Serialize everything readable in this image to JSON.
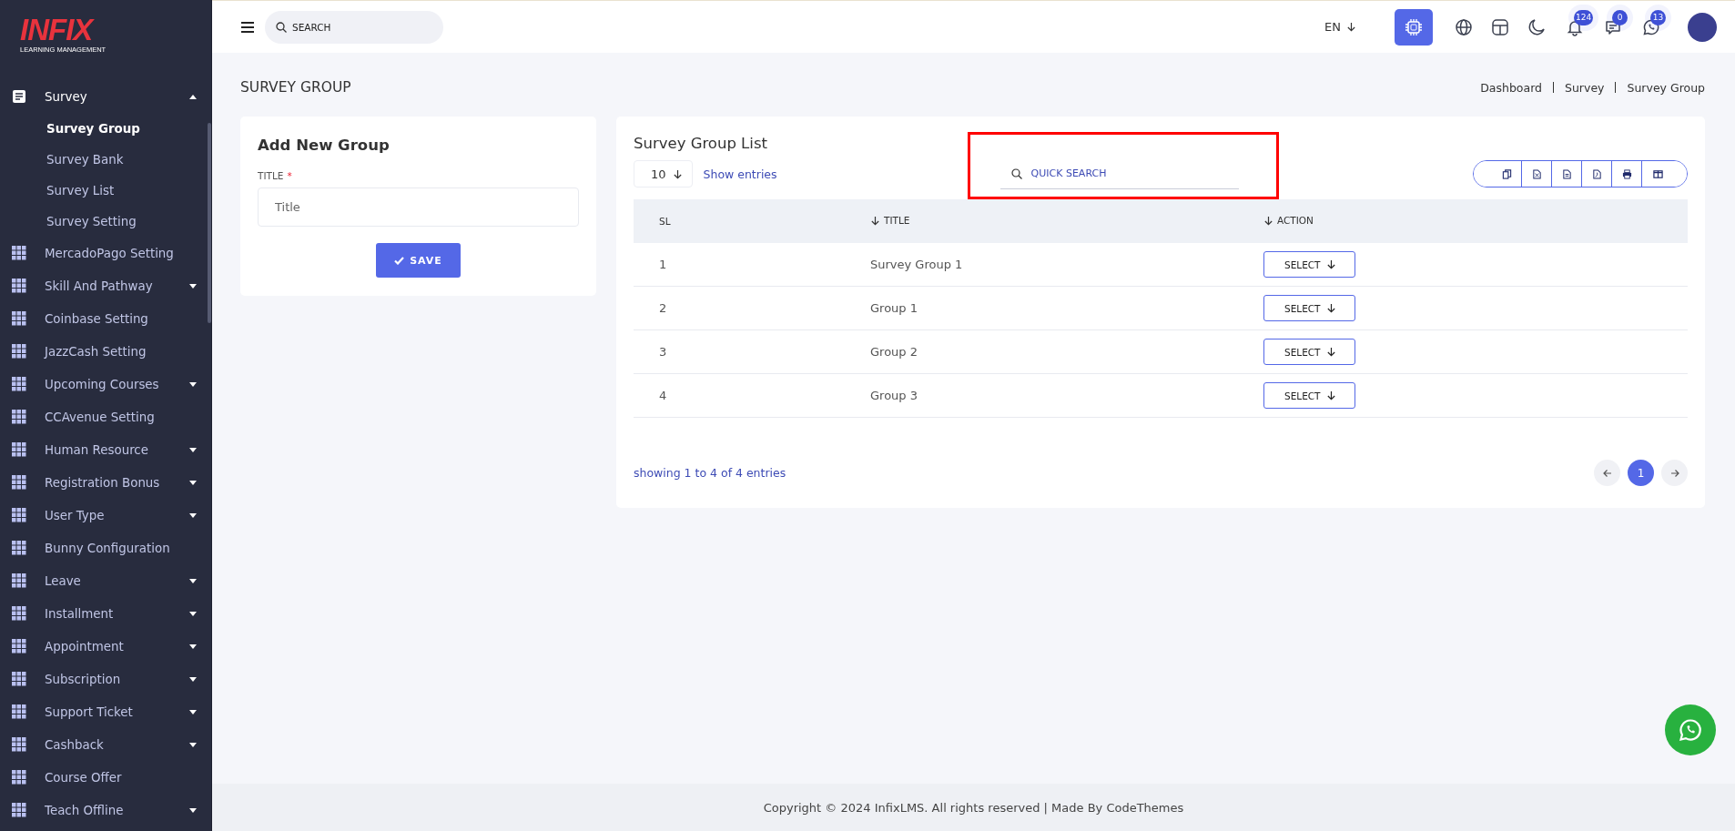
{
  "logo": {
    "wordmark": "INFIX",
    "tagline": "LEARNING MANAGEMENT"
  },
  "sidebar": {
    "items": [
      {
        "label": "Survey",
        "kind": "doc",
        "expandable": true,
        "expanded": true,
        "children": [
          {
            "label": "Survey Group",
            "selected": true
          },
          {
            "label": "Survey Bank",
            "selected": false
          },
          {
            "label": "Survey List",
            "selected": false
          },
          {
            "label": "Survey Setting",
            "selected": false
          }
        ]
      },
      {
        "label": "MercadoPago Setting",
        "kind": "grid",
        "expandable": false
      },
      {
        "label": "Skill And Pathway",
        "kind": "grid",
        "expandable": true,
        "expanded": false
      },
      {
        "label": "Coinbase Setting",
        "kind": "grid",
        "expandable": false
      },
      {
        "label": "JazzCash Setting",
        "kind": "grid",
        "expandable": false
      },
      {
        "label": "Upcoming Courses",
        "kind": "grid",
        "expandable": true,
        "expanded": false
      },
      {
        "label": "CCAvenue Setting",
        "kind": "grid",
        "expandable": false
      },
      {
        "label": "Human Resource",
        "kind": "grid",
        "expandable": true,
        "expanded": false
      },
      {
        "label": "Registration Bonus",
        "kind": "grid",
        "expandable": true,
        "expanded": false
      },
      {
        "label": "User Type",
        "kind": "grid",
        "expandable": true,
        "expanded": false
      },
      {
        "label": "Bunny Configuration",
        "kind": "grid",
        "expandable": false
      },
      {
        "label": "Leave",
        "kind": "grid",
        "expandable": true,
        "expanded": false
      },
      {
        "label": "Installment",
        "kind": "grid",
        "expandable": true,
        "expanded": false
      },
      {
        "label": "Appointment",
        "kind": "grid",
        "expandable": true,
        "expanded": false
      },
      {
        "label": "Subscription",
        "kind": "grid",
        "expandable": true,
        "expanded": false
      },
      {
        "label": "Support Ticket",
        "kind": "grid",
        "expandable": true,
        "expanded": false
      },
      {
        "label": "Cashback",
        "kind": "grid",
        "expandable": true,
        "expanded": false
      },
      {
        "label": "Course Offer",
        "kind": "grid",
        "expandable": false
      },
      {
        "label": "Teach Offline",
        "kind": "grid",
        "expandable": true,
        "expanded": false
      }
    ]
  },
  "topbar": {
    "search": {
      "placeholder": "SEARCH"
    },
    "language": "EN",
    "badges": [
      {
        "kind": "bell",
        "count": "124"
      },
      {
        "kind": "chat",
        "count": "0"
      },
      {
        "kind": "whatsapp",
        "count": "13"
      }
    ]
  },
  "page_title": "SURVEY GROUP",
  "breadcrumb": [
    "Dashboard",
    "Survey",
    "Survey Group"
  ],
  "add_form": {
    "title": "Add New Group",
    "field_label": "TITLE",
    "required_mark": "*",
    "placeholder": "Title",
    "button": "SAVE"
  },
  "list": {
    "title": "Survey Group List",
    "page_size": "10",
    "show_entries": "Show entries",
    "search": {
      "placeholder": "QUICK SEARCH",
      "highlighted": true
    },
    "export_buttons": [
      {
        "kind": "copy"
      },
      {
        "kind": "excel"
      },
      {
        "kind": "csv"
      },
      {
        "kind": "pdf"
      },
      {
        "kind": "print"
      },
      {
        "kind": "columns"
      }
    ],
    "columns": [
      {
        "label": "SL",
        "sortable": false
      },
      {
        "label": "TITLE",
        "sortable": true
      },
      {
        "label": "ACTION",
        "sortable": true
      }
    ],
    "rows": [
      {
        "sl": "1",
        "title": "Survey Group 1",
        "action": "SELECT"
      },
      {
        "sl": "2",
        "title": "Group 1",
        "action": "SELECT"
      },
      {
        "sl": "3",
        "title": "Group 2",
        "action": "SELECT"
      },
      {
        "sl": "4",
        "title": "Group 3",
        "action": "SELECT"
      }
    ],
    "summary": "showing 1 to 4 of 4 entries",
    "pages": [
      {
        "label": "1",
        "selected": true
      }
    ]
  },
  "footer": "Copyright © 2024 InfixLMS. All rights reserved | Made By CodeThemes"
}
